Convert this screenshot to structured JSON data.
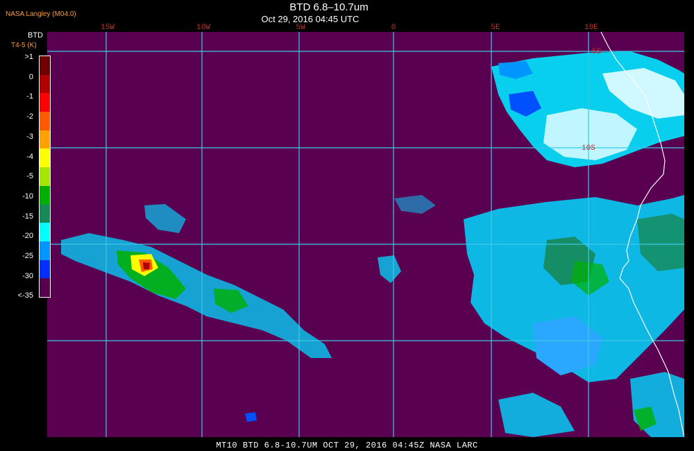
{
  "header": {
    "producer": "NASA Langley (M04.0)",
    "title": "BTD 6.8–10.7um",
    "datetime": "Oct 29, 2016 04:45 UTC"
  },
  "legend": {
    "title": "BTD",
    "subtitle": "T4-5 (K)",
    "labels": [
      ">1",
      "0",
      "-1",
      "-2",
      "-3",
      "-4",
      "-5",
      "-10",
      "-15",
      "-20",
      "-25",
      "-30",
      "<-35"
    ],
    "colors": [
      "#6e0000",
      "#b00000",
      "#ff0000",
      "#ff5a00",
      "#ffa200",
      "#ffff00",
      "#a6e600",
      "#00b000",
      "#168a56",
      "#00ffff",
      "#0096ff",
      "#0030ff",
      "#5a0050"
    ]
  },
  "map": {
    "background": "#5a0050",
    "grid_color": "#3ec8e8",
    "coast_color": "#ffffff",
    "lon_labels": [
      {
        "text": "15W",
        "lon": -15
      },
      {
        "text": "10W",
        "lon": -10
      },
      {
        "text": "5W",
        "lon": -5
      },
      {
        "text": "0",
        "lon": 0
      },
      {
        "text": "5E",
        "lon": 5
      },
      {
        "text": "10E",
        "lon": 10
      }
    ],
    "lat_labels": [
      {
        "text": "5S",
        "lat": -5
      },
      {
        "text": "10S",
        "lat": -10
      }
    ]
  },
  "footer": {
    "text": "MT10   BTD 6.8-10.7UM   OCT 29, 2016 04:45Z   NASA LARC"
  }
}
